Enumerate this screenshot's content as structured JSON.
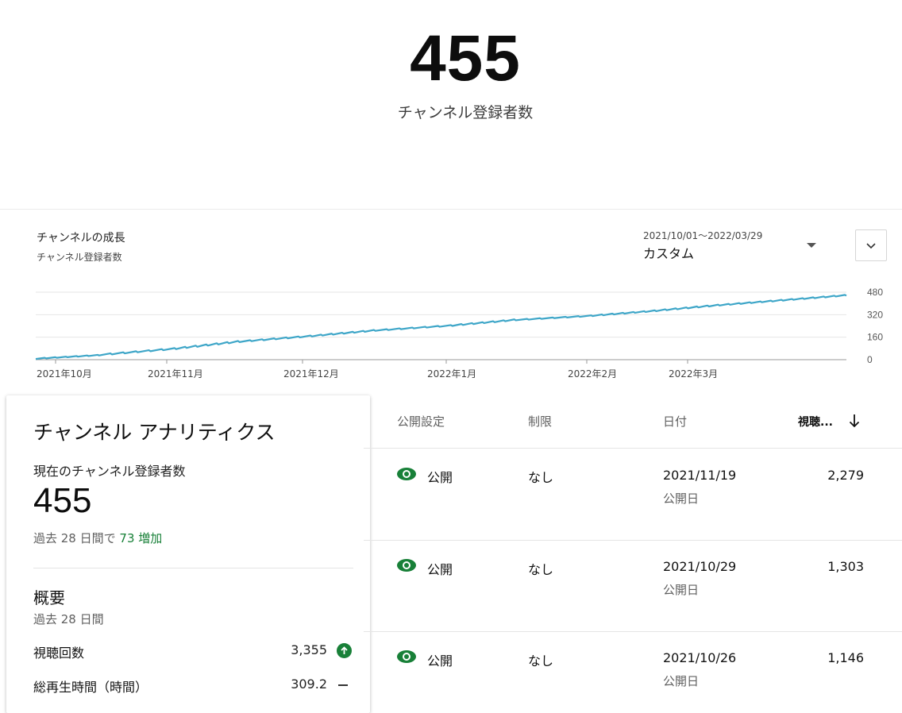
{
  "header": {
    "subscriber_count": "455",
    "subscriber_label": "チャンネル登録者数"
  },
  "growth": {
    "title": "チャンネルの成長",
    "subtitle": "チャンネル登録者数",
    "date_range": "2021/10/01～2022/03/29",
    "period": "カスタム",
    "period_icon": "caret-down-icon",
    "expand_icon": "chevron-down-icon"
  },
  "chart_data": {
    "type": "line",
    "title": "チャンネルの成長",
    "subtitle": "チャンネル登録者数",
    "x_tick_labels": [
      "2021年10月",
      "2021年11月",
      "2021年12月",
      "2022年1月",
      "2022年2月",
      "2022年3月"
    ],
    "y_tick_labels": [
      "0",
      "160",
      "320",
      "480"
    ],
    "ylim": [
      0,
      480
    ],
    "xlim": [
      "2021-10-01",
      "2022-03-29"
    ],
    "grid": true,
    "color": "#3ea6c8",
    "series": [
      {
        "x": [
          "2021-10-01",
          "2021-10-15",
          "2021-11-01",
          "2021-11-15",
          "2021-12-01",
          "2021-12-15",
          "2022-01-01",
          "2022-01-15",
          "2022-02-01",
          "2022-02-15",
          "2022-03-01",
          "2022-03-15",
          "2022-03-29"
        ],
        "y": [
          5,
          30,
          75,
          125,
          165,
          205,
          240,
          280,
          310,
          345,
          385,
          420,
          455
        ]
      }
    ]
  },
  "analytics": {
    "title": "チャンネル アナリティクス",
    "current_subs_label": "現在のチャンネル登録者数",
    "current_subs_value": "455",
    "delta_prefix": "過去 28 日間で",
    "delta_value": "73 増加",
    "summary_title": "概要",
    "summary_period": "過去 28 日間",
    "metrics": [
      {
        "label": "視聴回数",
        "value": "3,355",
        "trend": "arrow-up-icon"
      },
      {
        "label": "総再生時間（時間）",
        "value": "309.2",
        "trend": "dash-icon"
      }
    ],
    "colors": {
      "increase": "#188038"
    }
  },
  "table": {
    "headers": {
      "visibility": "公開設定",
      "restriction": "制限",
      "date": "日付",
      "views": "視聴..."
    },
    "sort_icon": "arrow-down-icon",
    "rows": [
      {
        "visibility": "公開",
        "restriction": "なし",
        "date": "2021/11/19",
        "date_sub": "公開日",
        "views": "2,279"
      },
      {
        "visibility": "公開",
        "restriction": "なし",
        "date": "2021/10/29",
        "date_sub": "公開日",
        "views": "1,303"
      },
      {
        "visibility": "公開",
        "restriction": "なし",
        "date": "2021/10/26",
        "date_sub": "公開日",
        "views": "1,146"
      }
    ],
    "colors": {
      "public_eye": "#188038"
    }
  }
}
